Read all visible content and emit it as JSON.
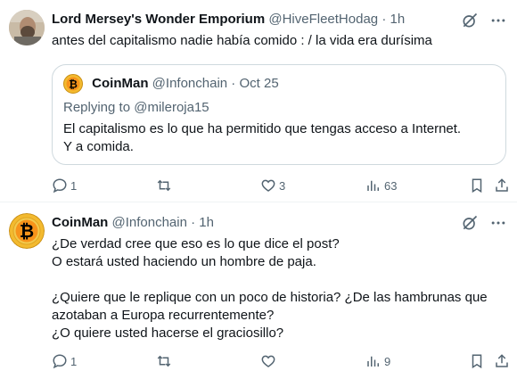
{
  "tweets": [
    {
      "author_name": "Lord Mersey's Wonder Emporium",
      "author_handle": "@HiveFleetHodag",
      "separator": "·",
      "time": "1h",
      "text_lines": [
        "antes del capitalismo nadie había comido : / la vida era durísima"
      ],
      "quote": {
        "author_name": "CoinMan",
        "author_handle": "@Infonchain",
        "separator": "·",
        "date": "Oct 25",
        "replying_to_label": "Replying to",
        "replying_to_handle": "@mileroja15",
        "text_lines": [
          "El capitalismo es lo que ha permitido que tengas acceso a Internet.",
          "Y a comida."
        ]
      },
      "actions": {
        "replies": "1",
        "retweets": "",
        "likes": "3",
        "views": "63"
      }
    },
    {
      "author_name": "CoinMan",
      "author_handle": "@Infonchain",
      "separator": "·",
      "time": "1h",
      "text_lines": [
        "¿De verdad cree que eso es lo que dice el post?",
        "O estará usted haciendo un hombre de paja.",
        "",
        "¿Quiere que le replique con un poco de historia? ¿De las hambrunas que",
        "azotaban a Europa recurrentemente?",
        "¿O quiere usted hacerse el graciosillo?"
      ],
      "actions": {
        "replies": "1",
        "retweets": "",
        "likes": "",
        "views": "9"
      }
    }
  ],
  "icons": {
    "grok": "grok-icon",
    "more": "more-icon",
    "reply": "reply-icon",
    "retweet": "retweet-icon",
    "like": "like-icon",
    "views": "views-icon",
    "bookmark": "bookmark-icon",
    "share": "share-icon",
    "bitcoin": "bitcoin-avatar-icon"
  },
  "colors": {
    "text": "#0f1419",
    "secondary": "#536471",
    "border": "#cfd9de",
    "bitcoin_orange": "#f7931a",
    "bitcoin_yellow": "#f3ba2f"
  }
}
